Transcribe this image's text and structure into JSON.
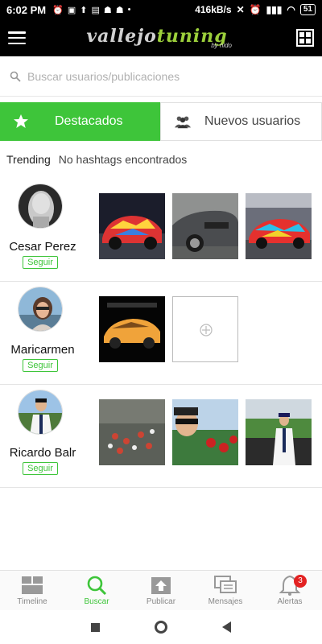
{
  "status_bar": {
    "time": "6:02 PM",
    "speed": "416kB/s",
    "battery": "51"
  },
  "header": {
    "logo_main": "vallejo",
    "logo_accent": "tuning",
    "logo_sub": "by nido"
  },
  "search": {
    "placeholder": "Buscar usuarios/publicaciones"
  },
  "tabs": [
    {
      "label": "Destacados",
      "icon": "star-icon",
      "active": true
    },
    {
      "label": "Nuevos usuarios",
      "icon": "users-icon",
      "active": false
    }
  ],
  "trending": {
    "label": "Trending",
    "message": "No hashtags encontrados"
  },
  "users": [
    {
      "name": "Cesar Perez",
      "follow_label": "Seguir",
      "posts": 3
    },
    {
      "name": "Maricarmen",
      "follow_label": "Seguir",
      "posts": 1
    },
    {
      "name": "Ricardo Balr",
      "follow_label": "Seguir",
      "posts": 3
    }
  ],
  "bottom_nav": [
    {
      "label": "Timeline",
      "icon": "timeline-icon",
      "active": false
    },
    {
      "label": "Buscar",
      "icon": "search-icon",
      "active": true
    },
    {
      "label": "Publicar",
      "icon": "publish-icon",
      "active": false
    },
    {
      "label": "Mensajes",
      "icon": "messages-icon",
      "active": false
    },
    {
      "label": "Alertas",
      "icon": "bell-icon",
      "active": false,
      "badge": "3"
    }
  ],
  "colors": {
    "accent": "#3ec53a",
    "header_bg": "#000000",
    "badge": "#e32222"
  }
}
